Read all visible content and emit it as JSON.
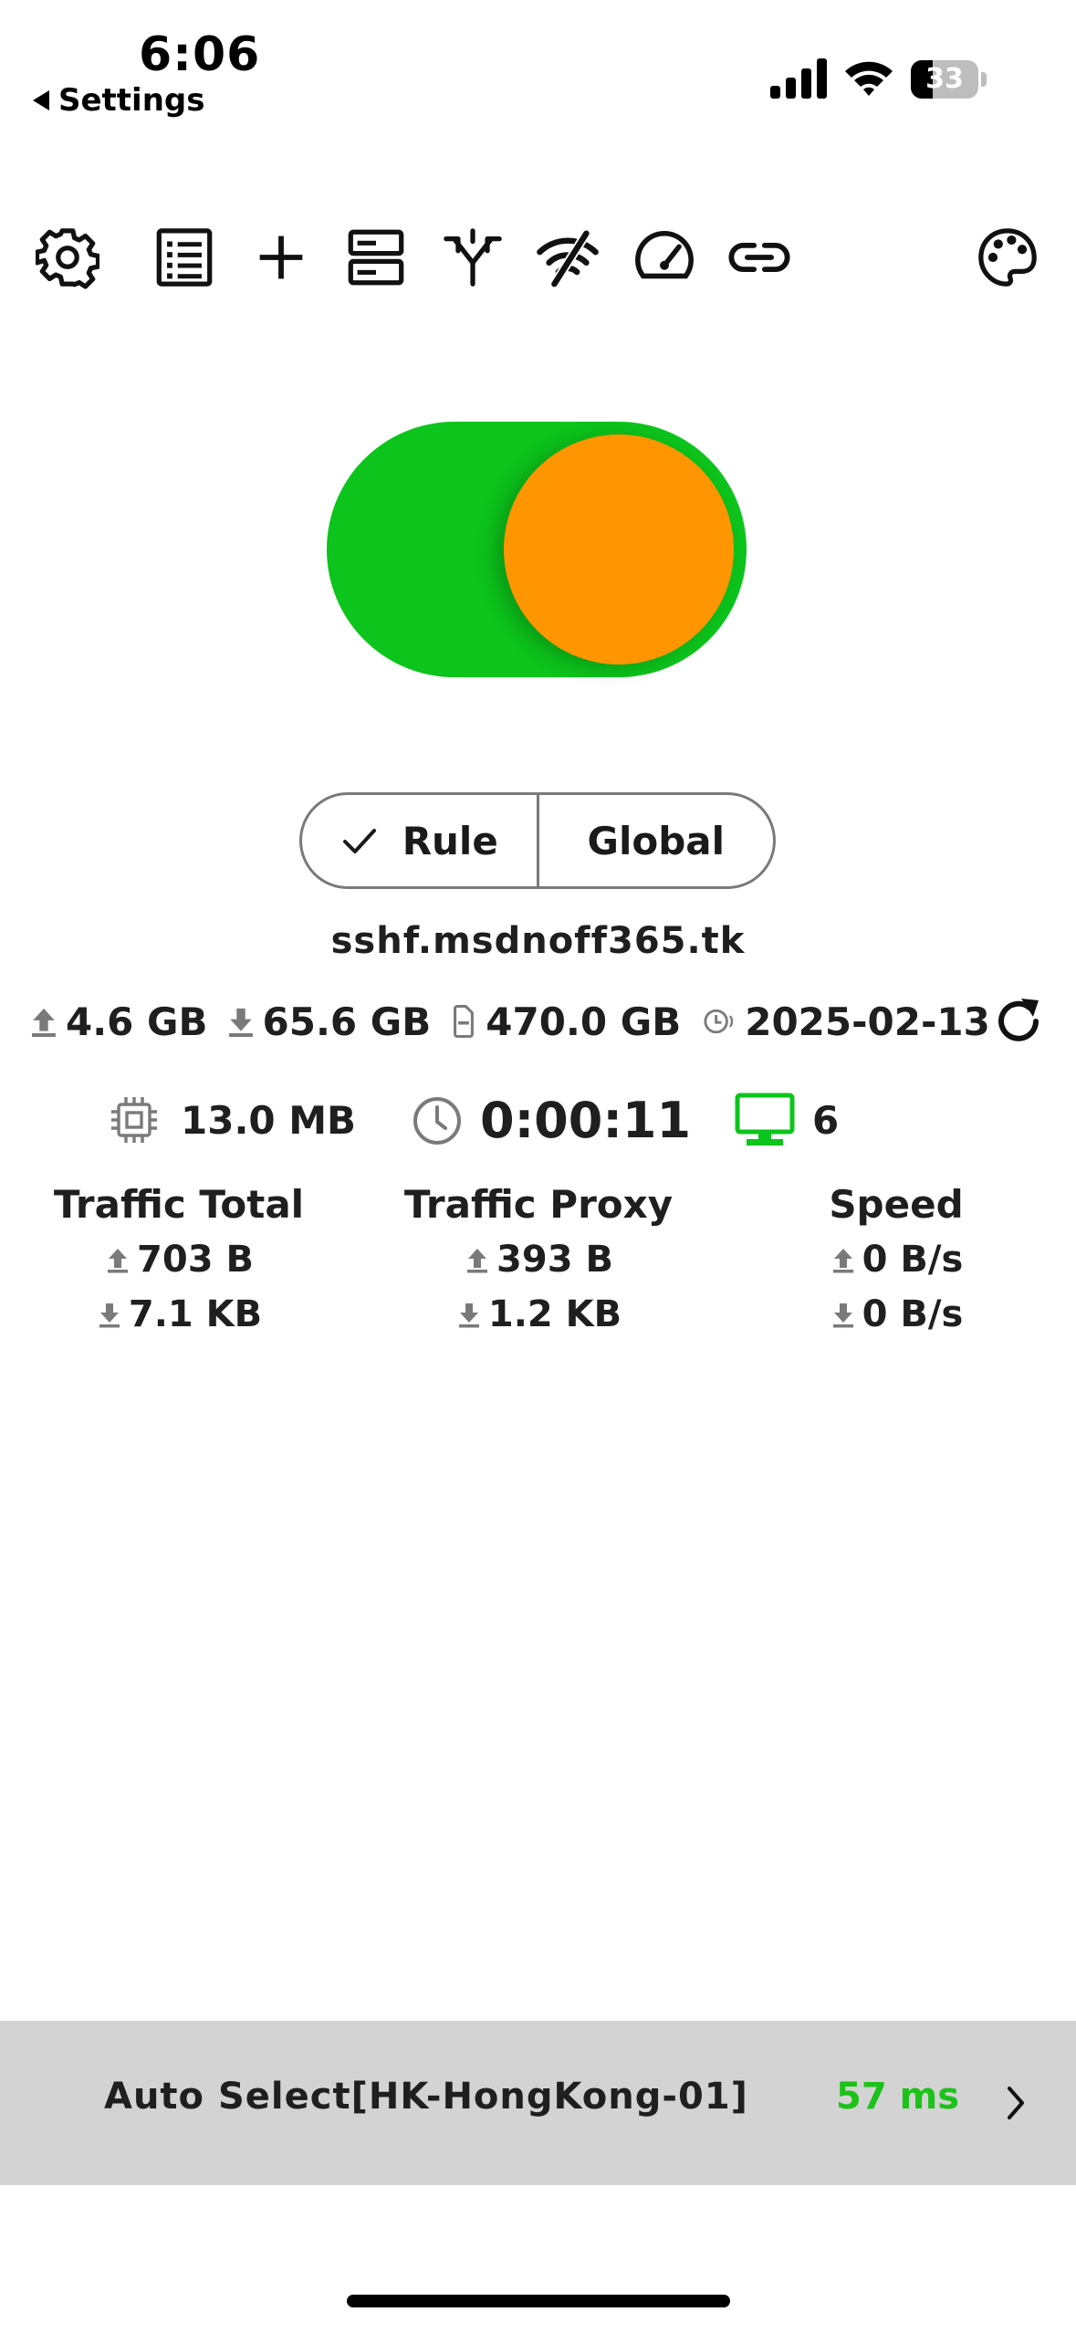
{
  "status_bar": {
    "time": "6:06",
    "back_label": "Settings",
    "battery": "33",
    "battery_level": 0.33
  },
  "toolbar": {
    "icons": [
      "gear-icon",
      "list-icon",
      "plus-icon",
      "servers-icon",
      "routing-icon",
      "wifi-off-icon",
      "speedometer-icon",
      "link-icon",
      "palette-icon"
    ]
  },
  "connection": {
    "state": "on",
    "toggle_color": "#0cc41b",
    "knob_color": "#ff9500"
  },
  "mode": {
    "rule_label": "Rule",
    "global_label": "Global",
    "selected": "Rule"
  },
  "profile": {
    "host": "sshf.msdnoff365.tk",
    "upload": "4.6 GB",
    "download": "65.6 GB",
    "total": "470.0 GB",
    "expiry": "2025-02-13"
  },
  "stats": {
    "memory": "13.0 MB",
    "uptime": "0:00:11",
    "devices": "6",
    "traffic_total": {
      "title": "Traffic Total",
      "up": "703 B",
      "down": "7.1 KB"
    },
    "traffic_proxy": {
      "title": "Traffic Proxy",
      "up": "393 B",
      "down": "1.2 KB"
    },
    "speed": {
      "title": "Speed",
      "up": "0 B/s",
      "down": "0 B/s"
    }
  },
  "proxy": {
    "name": "Auto Select[HK-HongKong-01]",
    "latency": "57 ms",
    "latency_color": "#1cc21a"
  }
}
